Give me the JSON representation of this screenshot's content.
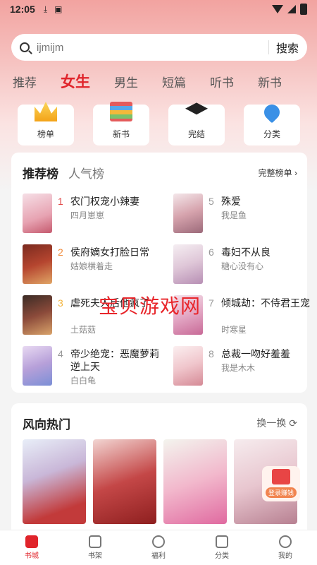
{
  "status_bar": {
    "time": "12:05"
  },
  "search": {
    "placeholder": "ijmijm",
    "button": "搜索"
  },
  "tabs": [
    "推荐",
    "女生",
    "男生",
    "短篇",
    "听书",
    "新书"
  ],
  "quick_links": [
    {
      "label": "榜单",
      "icon": "crown-icon",
      "color": "#f3b53f"
    },
    {
      "label": "新书",
      "icon": "books-icon",
      "color": "#58a7e8"
    },
    {
      "label": "完结",
      "icon": "graduation-cap-icon",
      "color": "#222222"
    },
    {
      "label": "分类",
      "icon": "rocket-icon",
      "color": "#3a90e6"
    }
  ],
  "ranking": {
    "tabs": [
      "推荐榜",
      "人气榜"
    ],
    "full_list_label": "完整榜单 ›",
    "items": [
      {
        "rank": "1",
        "title": "农门权宠小辣妻",
        "author": "四月崽崽"
      },
      {
        "rank": "2",
        "title": "侯府嫡女打脸日常",
        "author": "姑娘横着走"
      },
      {
        "rank": "3",
        "title": "虐死夫人后他疯了",
        "author": "土菇菇"
      },
      {
        "rank": "4",
        "title": "帝少绝宠：恶魔萝莉逆上天",
        "author": "白白龟"
      },
      {
        "rank": "5",
        "title": "殊爱",
        "author": "我是鱼"
      },
      {
        "rank": "6",
        "title": "毒妇不从良",
        "author": "糖心没有心"
      },
      {
        "rank": "7",
        "title": "倾城劫：不侍君王宠",
        "author": "时寒星"
      },
      {
        "rank": "8",
        "title": "总裁一吻好羞羞",
        "author": "我是木木"
      }
    ]
  },
  "watermark": "宝贝游戏网",
  "hot": {
    "title": "风向热门",
    "refresh_label": "换一换 ⟳",
    "gift_label": "登录赚钱"
  },
  "bottom_nav": [
    "书城",
    "书架",
    "福利",
    "分类",
    "我的"
  ]
}
